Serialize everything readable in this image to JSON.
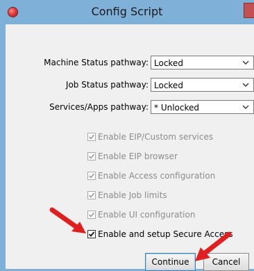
{
  "window": {
    "title": "Config Script"
  },
  "fields": [
    {
      "label": "Machine Status pathway:",
      "value": "Locked"
    },
    {
      "label": "Job Status pathway:",
      "value": "Locked"
    },
    {
      "label": "Services/Apps pathway:",
      "value": "* Unlocked"
    }
  ],
  "checkboxes": [
    {
      "label": "Enable EIP/Custom services",
      "checked": true,
      "enabled": false
    },
    {
      "label": "Enable EIP browser",
      "checked": true,
      "enabled": false
    },
    {
      "label": "Enable Access configuration",
      "checked": true,
      "enabled": false
    },
    {
      "label": "Enable Job limits",
      "checked": true,
      "enabled": false
    },
    {
      "label": "Enable UI configuration",
      "checked": true,
      "enabled": false
    },
    {
      "label": "Enable and setup Secure Access",
      "checked": true,
      "enabled": true
    }
  ],
  "buttons": {
    "continue": "Continue",
    "cancel": "Cancel"
  },
  "colors": {
    "annotation_arrow": "#e02020",
    "title_bar": "#7fb0d8",
    "close_button": "#e23b3b"
  }
}
